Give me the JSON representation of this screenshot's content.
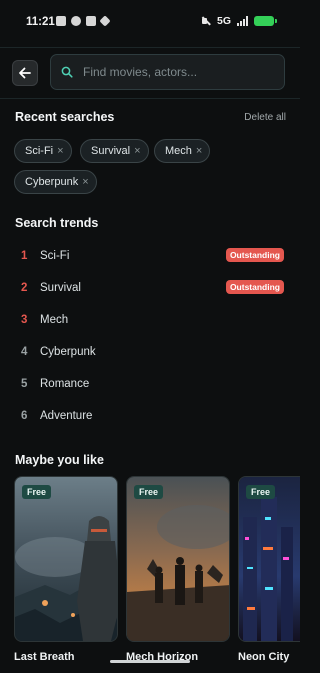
{
  "status_bar": {
    "time": "11:21",
    "network": "5G",
    "battery_level": 1.0
  },
  "search": {
    "placeholder": "Find movies, actors..."
  },
  "recent": {
    "title": "Recent searches",
    "delete_label": "Delete all",
    "chips": [
      "Sci-Fi",
      "Survival",
      "Mech",
      "Cyberpunk"
    ],
    "remove_icon": "×"
  },
  "trends": {
    "title": "Search trends",
    "items": [
      {
        "rank": "1",
        "name": "Sci-Fi",
        "badge": "Outstanding"
      },
      {
        "rank": "2",
        "name": "Survival",
        "badge": "Outstanding"
      },
      {
        "rank": "3",
        "name": "Mech",
        "badge": ""
      },
      {
        "rank": "4",
        "name": "Cyberpunk",
        "badge": ""
      },
      {
        "rank": "5",
        "name": "Romance",
        "badge": ""
      },
      {
        "rank": "6",
        "name": "Adventure",
        "badge": ""
      }
    ]
  },
  "maybe": {
    "title": "Maybe you like",
    "cards": [
      {
        "title": "Last Breath",
        "badge": "Free"
      },
      {
        "title": "Mech Horizon",
        "badge": "Free"
      },
      {
        "title": "Neon City",
        "badge": "Free"
      }
    ]
  },
  "colors": {
    "accent": "#4fd1b5",
    "hot_rank": "#e4574f",
    "badge_bg": "#e4574f",
    "free_badge_bg": "#1e4a43"
  }
}
